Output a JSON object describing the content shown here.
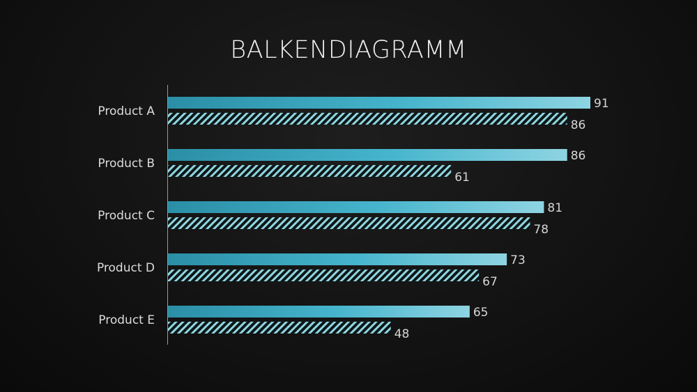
{
  "slide": {
    "title": "BALKENDIAGRAMM"
  },
  "chart_data": {
    "type": "bar",
    "orientation": "horizontal",
    "title": "BALKENDIAGRAMM",
    "categories": [
      "Product A",
      "Product B",
      "Product C",
      "Product D",
      "Product E"
    ],
    "series": [
      {
        "values": [
          91,
          86,
          81,
          73,
          65
        ],
        "style": "gradient",
        "color": "#2fa0ba"
      },
      {
        "values": [
          86,
          61,
          78,
          67,
          48
        ],
        "style": "hatched",
        "color": "#8fd6e0"
      }
    ],
    "xlim": [
      0,
      91
    ],
    "grid": false,
    "legend": "none",
    "data_labels": true
  }
}
